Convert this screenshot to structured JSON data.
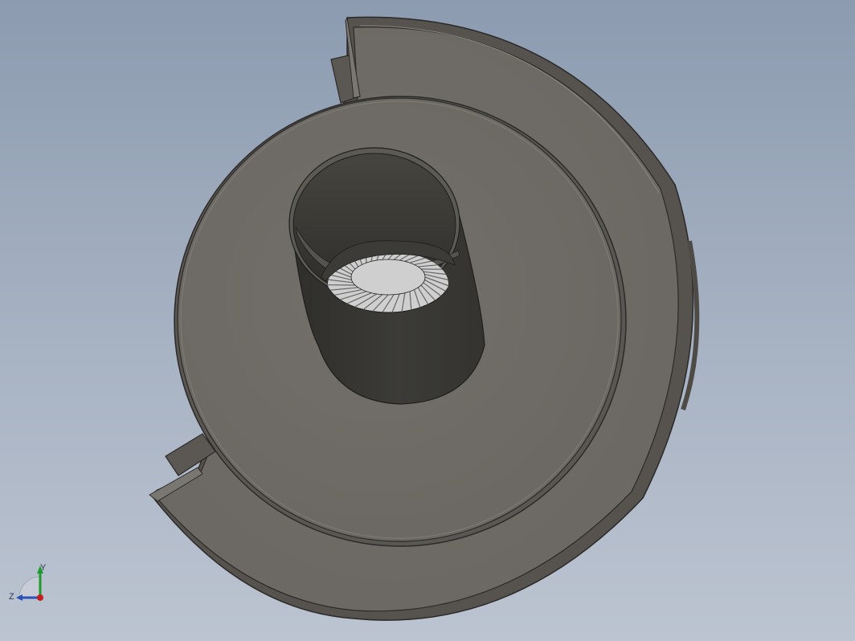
{
  "viewport": {
    "background_top": "#8c9bb0",
    "background_bottom": "#bcc4d1"
  },
  "model": {
    "part_face_color": "#6f6b66",
    "part_edge_color": "#2b2a28",
    "tube_color": "#3b3a37",
    "fins_color": "#d9d9d9"
  },
  "triad": {
    "y_label": "Y",
    "z_label": "Z",
    "y_color": "#1f9a2e",
    "z_color": "#2c4fb8",
    "origin_color": "#c22020"
  }
}
